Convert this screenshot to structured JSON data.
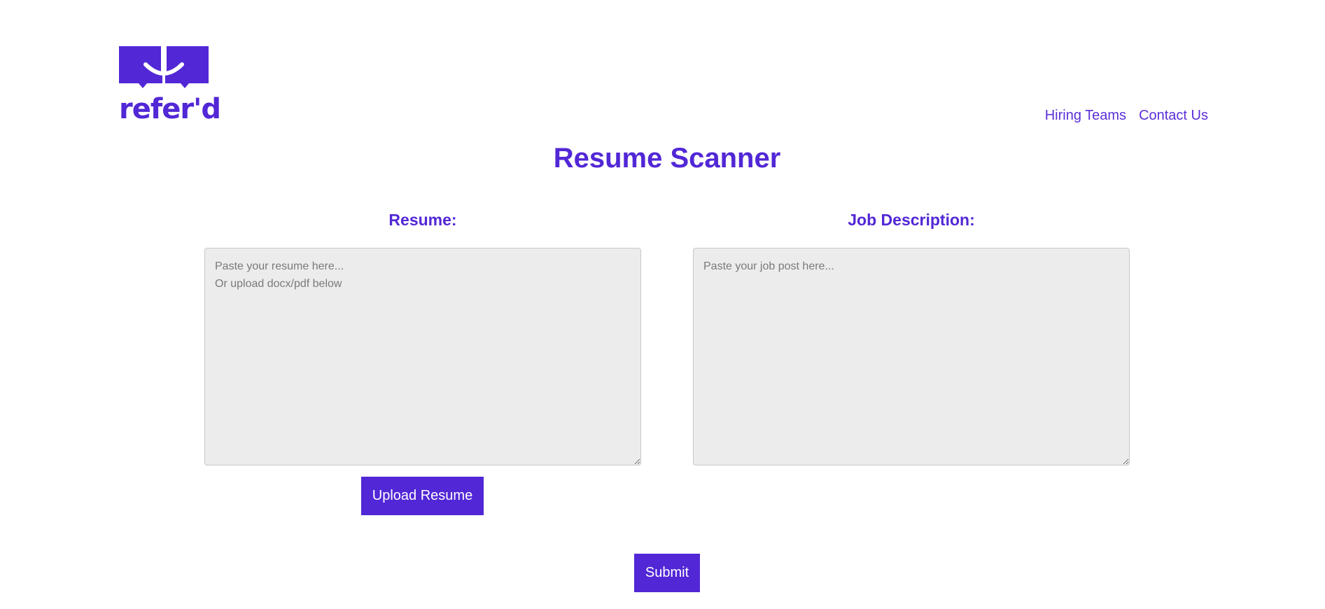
{
  "brand": {
    "logo_text": "refer'd",
    "color": "#5227d6"
  },
  "nav": {
    "hiring_teams": "Hiring Teams",
    "contact_us": "Contact Us"
  },
  "title": "Resume Scanner",
  "resume": {
    "label": "Resume:",
    "placeholder": "Paste your resume here...\nOr upload docx/pdf below",
    "value": "",
    "upload_label": "Upload Resume"
  },
  "job": {
    "label": "Job Description:",
    "placeholder": "Paste your job post here...",
    "value": ""
  },
  "submit_label": "Submit"
}
